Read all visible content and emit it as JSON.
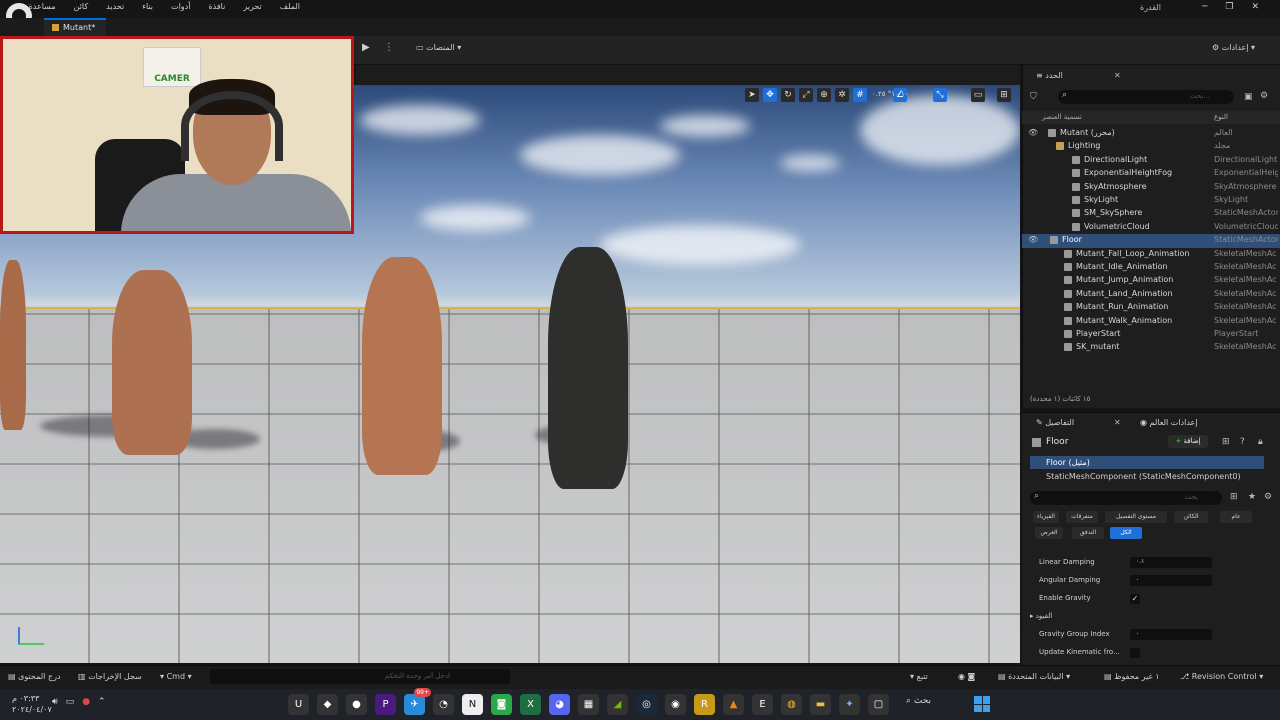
{
  "menu": [
    "الملف",
    "تحرير",
    "نافذة",
    "أدوات",
    "بناء",
    "تحديد",
    "كائن",
    "مساعدة"
  ],
  "window_title": "القدرة",
  "tab": {
    "label": "Mutant*"
  },
  "toolbar": {
    "platforms": "المنصات",
    "settings": "إعدادات"
  },
  "webcam": {
    "poster_text": "CAMER"
  },
  "viewport": {
    "numbers": "١٠   ١٠°   ٠.٢٥"
  },
  "outliner": {
    "tab": "الحدد",
    "search_placeholder": "بحث...",
    "col_name": "تسمية العنصر",
    "col_type": "النوع",
    "rows": [
      {
        "name": "Mutant (محرر)",
        "type": "العالم",
        "indent": 38,
        "icon": "level"
      },
      {
        "name": "Lighting",
        "type": "مجلد",
        "indent": 46,
        "icon": "folder"
      },
      {
        "name": "DirectionalLight",
        "type": "DirectionalLight",
        "indent": 62,
        "icon": "light"
      },
      {
        "name": "ExponentialHeightFog",
        "type": "ExponentialHeigh",
        "indent": 62,
        "icon": "fog"
      },
      {
        "name": "SkyAtmosphere",
        "type": "SkyAtmosphere",
        "indent": 62,
        "icon": "sky"
      },
      {
        "name": "SkyLight",
        "type": "SkyLight",
        "indent": 62,
        "icon": "light"
      },
      {
        "name": "SM_SkySphere",
        "type": "StaticMeshActor",
        "indent": 62,
        "icon": "mesh"
      },
      {
        "name": "VolumetricCloud",
        "type": "VolumetricCloud",
        "indent": 62,
        "icon": "cloud"
      },
      {
        "name": "Floor",
        "type": "StaticMeshActor",
        "indent": 40,
        "icon": "mesh",
        "selected": true
      },
      {
        "name": "Mutant_Fall_Loop_Animation",
        "type": "SkeletalMeshAc",
        "indent": 54,
        "icon": "skeletal"
      },
      {
        "name": "Mutant_Idle_Animation",
        "type": "SkeletalMeshAc",
        "indent": 54,
        "icon": "skeletal"
      },
      {
        "name": "Mutant_Jump_Animation",
        "type": "SkeletalMeshAc",
        "indent": 54,
        "icon": "skeletal"
      },
      {
        "name": "Mutant_Land_Animation",
        "type": "SkeletalMeshAc",
        "indent": 54,
        "icon": "skeletal"
      },
      {
        "name": "Mutant_Run_Animation",
        "type": "SkeletalMeshAc",
        "indent": 54,
        "icon": "skeletal"
      },
      {
        "name": "Mutant_Walk_Animation",
        "type": "SkeletalMeshAc",
        "indent": 54,
        "icon": "skeletal"
      },
      {
        "name": "PlayerStart",
        "type": "PlayerStart",
        "indent": 54,
        "icon": "player"
      },
      {
        "name": "SK_mutant",
        "type": "SkeletalMeshAc",
        "indent": 54,
        "icon": "skeletal"
      }
    ],
    "status": "١٥ كائنات (١ محددة)"
  },
  "details": {
    "tab": "التفاصيل",
    "world_settings_tab": "إعدادات العالم",
    "title": "Floor",
    "add_label": "إضافة",
    "selected_component": "Floor (مثيل)",
    "component": "StaticMeshComponent (StaticMeshComponent0)",
    "search_placeholder": "بحث",
    "filters_row1": [
      "عام",
      "الكائن",
      "مستوى التفصيل",
      "متفرقات",
      "الفيزياء"
    ],
    "filters_row2": [
      "العرض",
      "التدفق",
      "الكل"
    ],
    "props": [
      {
        "label": "Linear Damping",
        "value": "٠.١"
      },
      {
        "label": "Angular Damping",
        "value": "٠"
      },
      {
        "label": "Enable Gravity",
        "checked": true
      },
      {
        "label": "القيود",
        "section": true
      },
      {
        "label": "Gravity Group Index",
        "value": "٠"
      },
      {
        "label": "Update Kinematic fro...",
        "checked": false
      }
    ]
  },
  "statusbar": {
    "content_drawer": "درج المحتوى",
    "output_log": "سجل الإخراجات",
    "cmd": "Cmd",
    "cmd_placeholder": "ادخل أمر وحدة التحكم",
    "trace": "تتبع",
    "derived_data": "البيانات المتحددة",
    "unsaved": "١ غير محفوظ",
    "revision": "Revision Control"
  },
  "taskbar": {
    "search": "بحث",
    "time": "٠٣:٣٣ م",
    "date": "٢٠٢٤/٠٤/٠٧",
    "badge": "99+"
  },
  "colors": {
    "accent": "#1e6fd8",
    "selection": "#2f4f7a",
    "webcam_border": "#b81818",
    "horizon": "#e0b040"
  }
}
